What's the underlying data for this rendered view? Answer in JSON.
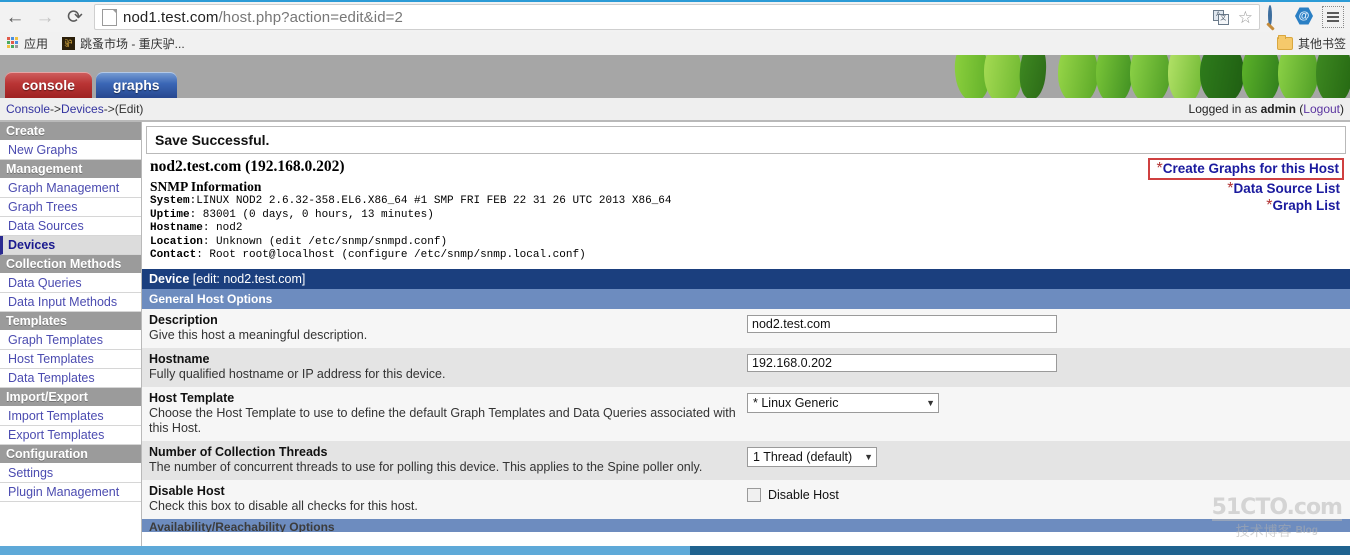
{
  "browser": {
    "back_icon": "←",
    "forward_icon": "→",
    "reload_icon": "⟳",
    "url_main": "nod1.test.com",
    "url_path": "/host.php?action=edit&id=2",
    "translate_icon": "translate-icon",
    "star_icon": "☆",
    "ext1_icon": "magnifier-extension-icon",
    "ext2_icon": "hexagon-extension-icon",
    "menu_icon": "hamburger-menu-icon",
    "bookmarks": {
      "apps_label": "应用",
      "item1_label": "跳蚤市场 - 重庆驴...",
      "other_label": "其他书签"
    }
  },
  "cacti": {
    "tabs": [
      {
        "label": "console",
        "active": true
      },
      {
        "label": "graphs",
        "active": false
      }
    ],
    "breadcrumb": {
      "part1": "Console",
      "sep1": " -> ",
      "part2": "Devices",
      "sep2": " -> ",
      "part3": "(Edit)"
    },
    "login_status": {
      "prefix": "Logged in as ",
      "user": "admin",
      "logout_open": " (",
      "logout": "Logout",
      "logout_close": ")"
    },
    "sidebar": [
      {
        "type": "head",
        "label": "Create"
      },
      {
        "type": "link",
        "label": "New Graphs",
        "current": false
      },
      {
        "type": "head",
        "label": "Management"
      },
      {
        "type": "link",
        "label": "Graph Management",
        "current": false
      },
      {
        "type": "link",
        "label": "Graph Trees",
        "current": false
      },
      {
        "type": "link",
        "label": "Data Sources",
        "current": false
      },
      {
        "type": "link",
        "label": "Devices",
        "current": true
      },
      {
        "type": "head",
        "label": "Collection Methods"
      },
      {
        "type": "link",
        "label": "Data Queries",
        "current": false
      },
      {
        "type": "link",
        "label": "Data Input Methods",
        "current": false
      },
      {
        "type": "head",
        "label": "Templates"
      },
      {
        "type": "link",
        "label": "Graph Templates",
        "current": false
      },
      {
        "type": "link",
        "label": "Host Templates",
        "current": false
      },
      {
        "type": "link",
        "label": "Data Templates",
        "current": false
      },
      {
        "type": "head",
        "label": "Import/Export"
      },
      {
        "type": "link",
        "label": "Import Templates",
        "current": false
      },
      {
        "type": "link",
        "label": "Export Templates",
        "current": false
      },
      {
        "type": "head",
        "label": "Configuration"
      },
      {
        "type": "link",
        "label": "Settings",
        "current": false
      },
      {
        "type": "link",
        "label": "Plugin Management",
        "current": false
      }
    ],
    "save_message": "Save Successful.",
    "host": {
      "title": "nod2.test.com (192.168.0.202)",
      "snmp_heading": "SNMP Information",
      "system_label": "System",
      "system_value": ":LINUX NOD2 2.6.32-358.EL6.X86_64 #1 SMP FRI FEB 22 31 26 UTC 2013 X86_64",
      "uptime_label": "Uptime",
      "uptime_value": ": 83001 (0 days, 0 hours, 13 minutes)",
      "hostname_label": "Hostname",
      "hostname_value": ": nod2",
      "location_label": "Location",
      "location_value": ": Unknown (edit /etc/snmp/snmpd.conf)",
      "contact_label": "Contact",
      "contact_value": ": Root root@localhost (configure /etc/snmp/snmp.local.conf)"
    },
    "host_links": {
      "asterisk": "*",
      "create_graphs": "Create Graphs for this Host",
      "data_source_list": "Data Source List",
      "graph_list": "Graph List"
    },
    "device_bar": {
      "title": "Device",
      "subtitle": " [edit: nod2.test.com]"
    },
    "section_general": "General Host Options",
    "fields": [
      {
        "name": "description",
        "title": "Description",
        "desc": "Give this host a meaningful description.",
        "control": "text",
        "value": "nod2.test.com"
      },
      {
        "name": "hostname",
        "title": "Hostname",
        "desc": "Fully qualified hostname or IP address for this device.",
        "control": "text",
        "value": "192.168.0.202"
      },
      {
        "name": "host-template",
        "title": "Host Template",
        "desc": "Choose the Host Template to use to define the default Graph Templates and Data Queries associated with this Host.",
        "control": "select",
        "value": "* Linux Generic"
      },
      {
        "name": "collection-threads",
        "title": "Number of Collection Threads",
        "desc": "The number of concurrent threads to use for polling this device. This applies to the Spine poller only.",
        "control": "select",
        "value": "1 Thread (default)"
      },
      {
        "name": "disable-host",
        "title": "Disable Host",
        "desc": "Check this box to disable all checks for this host.",
        "control": "checkbox",
        "value": "Disable Host",
        "checked": false
      }
    ],
    "section_availability": "Availability/Reachability Options"
  },
  "watermark": {
    "line1": "51CTO.com",
    "line2": "技术博客",
    "blog": "Blog"
  },
  "colors": {
    "accent_blue": "#1b3f7e",
    "section_blue": "#6d8cbf",
    "link_blue": "#1a1a9e",
    "highlight_red": "#cf4040",
    "tab_red": "#b93434",
    "tab_blue": "#3a66b5"
  }
}
